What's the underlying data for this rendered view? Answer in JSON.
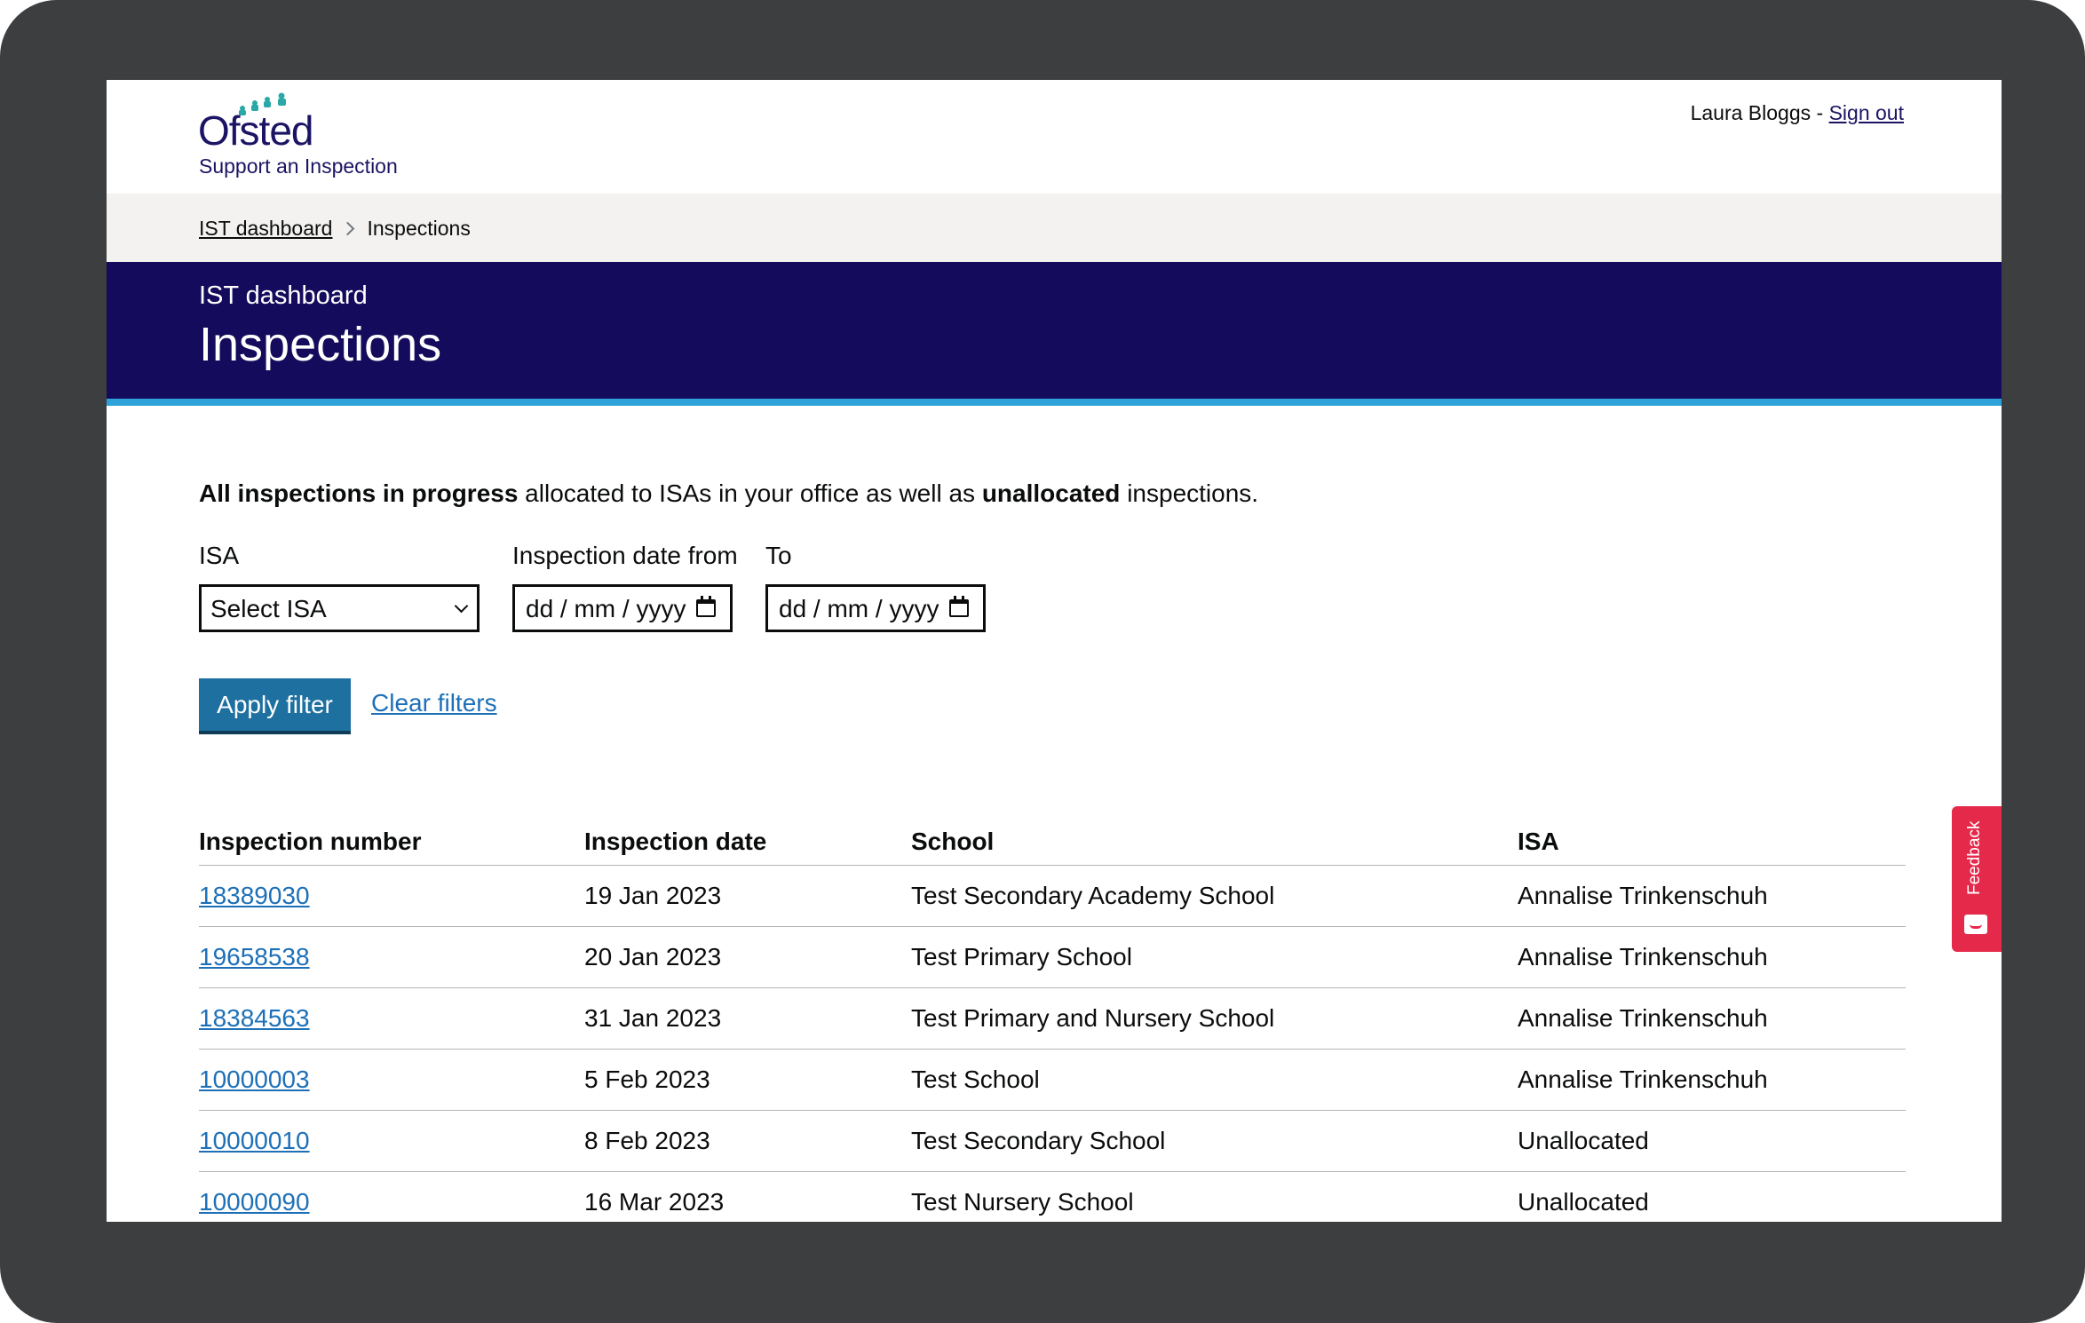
{
  "header": {
    "logo_text": "Ofsted",
    "service_name": "Support an Inspection",
    "user_name": "Laura Bloggs",
    "separator": "-",
    "sign_out": "Sign out"
  },
  "breadcrumb": [
    {
      "label": "IST dashboard"
    },
    {
      "label": "Inspections"
    }
  ],
  "banner": {
    "caption": "IST dashboard",
    "title": "Inspections"
  },
  "intro": {
    "bold1": "All inspections in progress",
    "text1": " allocated to ISAs in your office as well as ",
    "bold2": "unallocated",
    "text2": " inspections."
  },
  "filters": {
    "isa_label": "ISA",
    "isa_value": "Select ISA",
    "from_label": "Inspection date from",
    "from_placeholder": "dd / mm / yyyy",
    "to_label": "To",
    "to_placeholder": "dd / mm / yyyy",
    "apply": "Apply filter",
    "clear": "Clear filters"
  },
  "table": {
    "headers": [
      "Inspection number",
      "Inspection date",
      "School",
      "ISA"
    ],
    "rows": [
      {
        "number": "18389030",
        "date": "19 Jan 2023",
        "school": "Test Secondary Academy School",
        "isa": "Annalise Trinkenschuh"
      },
      {
        "number": "19658538",
        "date": "20 Jan 2023",
        "school": "Test Primary School",
        "isa": "Annalise Trinkenschuh"
      },
      {
        "number": "18384563",
        "date": "31 Jan 2023",
        "school": "Test Primary and Nursery School",
        "isa": "Annalise Trinkenschuh"
      },
      {
        "number": "10000003",
        "date": "5 Feb 2023",
        "school": "Test School",
        "isa": "Annalise Trinkenschuh"
      },
      {
        "number": "10000010",
        "date": "8 Feb 2023",
        "school": "Test Secondary School",
        "isa": "Unallocated"
      },
      {
        "number": "10000090",
        "date": "16 Mar 2023",
        "school": "Test Nursery School",
        "isa": "Unallocated"
      }
    ]
  },
  "feedback": {
    "label": "Feedback",
    "icon": "smile-chat-icon"
  },
  "colors": {
    "brand": "#1b1464",
    "banner": "#150b5c",
    "banner_border": "#2ea3d9",
    "button": "#1d70a0",
    "link": "#1d70b8",
    "feedback": "#e5294b"
  }
}
